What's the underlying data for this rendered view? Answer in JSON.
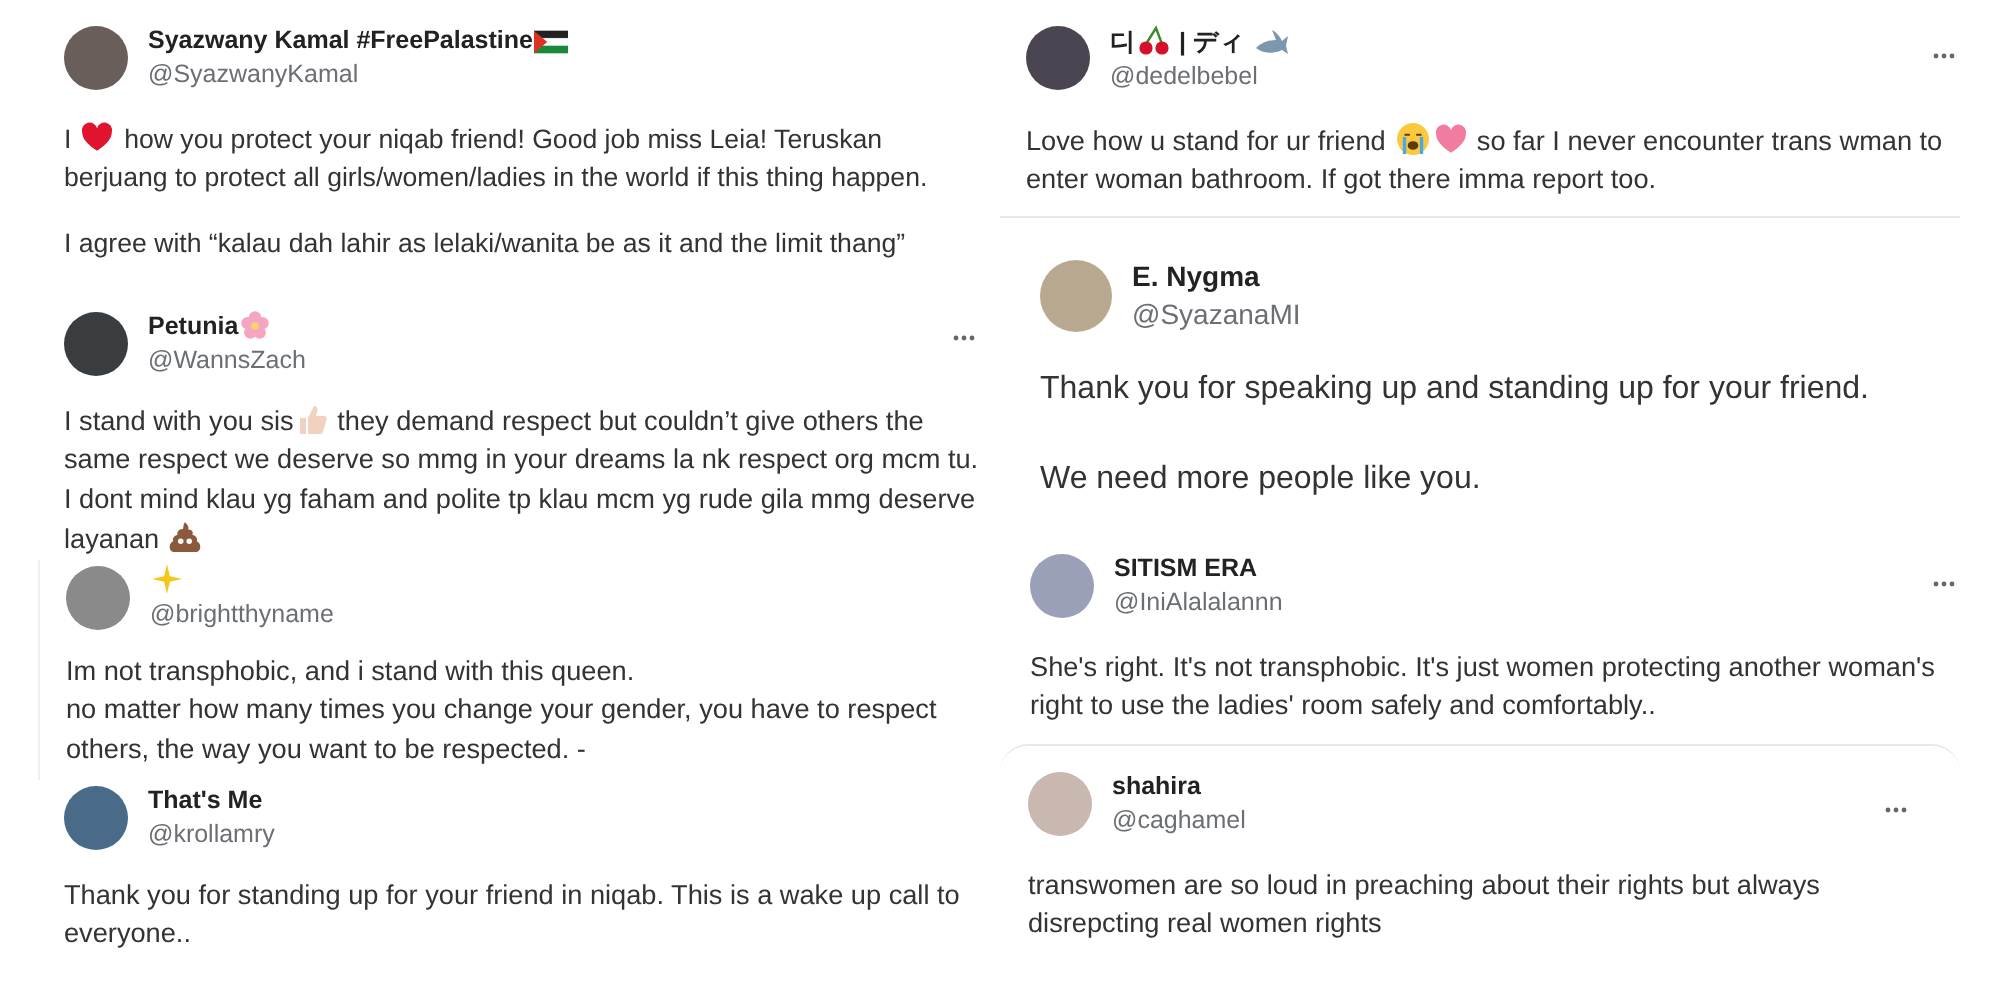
{
  "columns": [
    {
      "tweets": [
        {
          "name": [
            {
              "kind": "text",
              "text": "Syazwany Kamal #FreePalastine"
            },
            {
              "kind": "flag"
            }
          ],
          "handle": "@SyazwanyKamal",
          "menu": false,
          "body": [
            [
              {
                "kind": "text",
                "text": "I "
              },
              {
                "kind": "heart"
              },
              {
                "kind": "text",
                "text": " how you protect your niqab friend! Good job miss Leia! Teruskan berjuang to protect all girls/women/ladies in the world if this thing happen."
              }
            ],
            [
              {
                "kind": "text",
                "text": "I agree with “kalau dah lahir as lelaki/wanita be as it and the limit thang”"
              }
            ]
          ]
        },
        {
          "name": [
            {
              "kind": "text",
              "text": "Petunia"
            },
            {
              "kind": "flower"
            }
          ],
          "handle": "@WannsZach",
          "menu": true,
          "body": [
            [
              {
                "kind": "text",
                "text": "I stand with you sis"
              },
              {
                "kind": "thumbs"
              },
              {
                "kind": "text",
                "text": " they demand respect but couldn’t give others the same respect we deserve so mmg in your dreams la nk respect org mcm tu. I dont mind klau yg faham and polite tp klau mcm yg rude gila mmg deserve layanan "
              },
              {
                "kind": "poop"
              }
            ]
          ]
        },
        {
          "name": [
            {
              "kind": "sparkle"
            }
          ],
          "handle": "@brightthyname",
          "menu": false,
          "body": [
            [
              {
                "kind": "text",
                "text": "Im not transphobic, and i stand with this queen.\nno matter how many times you change your gender, you have to respect others, the way you want to be respected. -"
              }
            ]
          ]
        },
        {
          "name": [
            {
              "kind": "text",
              "text": "That's Me"
            }
          ],
          "handle": "@krollamry",
          "menu": false,
          "body": [
            [
              {
                "kind": "text",
                "text": "Thank you for standing up for your friend in niqab. This is a wake up call to everyone.."
              }
            ]
          ]
        }
      ]
    },
    {
      "tweets": [
        {
          "name": [
            {
              "kind": "text",
              "text": "디"
            },
            {
              "kind": "cherry"
            },
            {
              "kind": "text",
              "text": " | ディ "
            },
            {
              "kind": "shark"
            }
          ],
          "handle": "@dedelbebel",
          "menu": true,
          "body": [
            [
              {
                "kind": "text",
                "text": "Love how u stand for ur friend "
              },
              {
                "kind": "sob"
              },
              {
                "kind": "pinkheart"
              },
              {
                "kind": "text",
                "text": " so far I never encounter trans wman to enter woman bathroom. If got there imma report too."
              }
            ]
          ]
        },
        {
          "name": [
            {
              "kind": "text",
              "text": "E. Nygma"
            }
          ],
          "handle": "@SyazanaMI",
          "menu": false,
          "body": [
            [
              {
                "kind": "text",
                "text": "Thank you for speaking up and standing up for your friend."
              }
            ],
            [
              {
                "kind": "text",
                "text": "We need more people like you."
              }
            ]
          ]
        },
        {
          "name": [
            {
              "kind": "text",
              "text": "SITISM ERA"
            }
          ],
          "handle": "@IniAlalalannn",
          "menu": true,
          "body": [
            [
              {
                "kind": "text",
                "text": "She's right. It's not transphobic. It's just women protecting another woman's right to use the ladies' room safely and comfortably.."
              }
            ]
          ]
        },
        {
          "name": [
            {
              "kind": "text",
              "text": "shahira"
            }
          ],
          "handle": "@caghamel",
          "menu": true,
          "body": [
            [
              {
                "kind": "text",
                "text": "transwomen are so loud in preaching about their rights but always disrepcting real women rights"
              }
            ]
          ]
        }
      ]
    }
  ]
}
